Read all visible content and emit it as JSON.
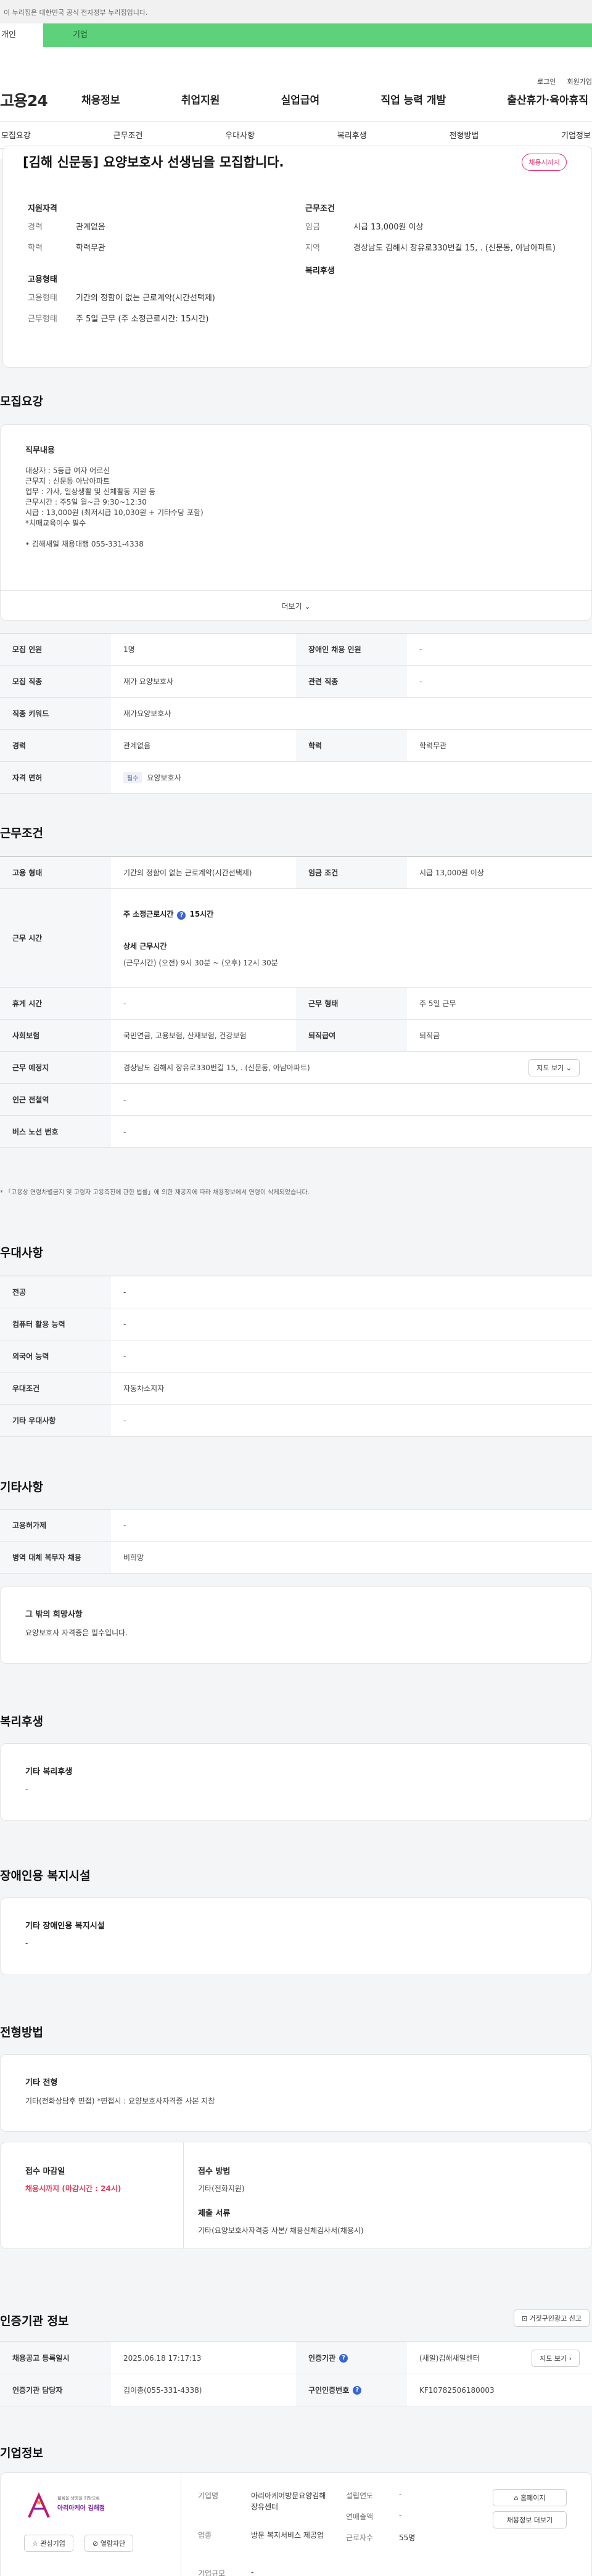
{
  "topbar": {
    "notice": "이 누리집은 대한민국 공식 전자정부 누리집입니다."
  },
  "tabs": {
    "person": "개인",
    "enterprise": "기업"
  },
  "header": {
    "login": "로그인",
    "signup": "회원가입",
    "logo": "고용24",
    "gnb": [
      "채용정보",
      "취업지원",
      "실업급여",
      "직업 능력 개발",
      "출산휴가·육아휴직"
    ],
    "anchors": [
      "모집요강",
      "근무조건",
      "우대사항",
      "복리후생",
      "전형방법",
      "기업정보"
    ]
  },
  "summary": {
    "title": "[김해 신문동] 요양보호사 선생님을 모집합니다.",
    "badge": "채용시까지",
    "qual_heading": "지원자격",
    "career_k": "경력",
    "career_v": "관계없음",
    "edu_k": "학력",
    "edu_v": "학력무관",
    "emp_heading": "고용형태",
    "emptype_k": "고용형태",
    "emptype_v": "기간의 정함이 없는 근로계약(시간선택제)",
    "worktype_k": "근무형태",
    "worktype_v": "주 5일 근무 (주 소정근로시간: 15시간)",
    "cond_heading": "근무조건",
    "wage_k": "임금",
    "wage_v": "시급 13,000원 이상",
    "region_k": "지역",
    "region_v": "경상남도 김해시 장유로330번길 15, . (신문동, 아남아파트)",
    "welfare_heading": "복리후생"
  },
  "recruit": {
    "heading": "모집요강",
    "duty_heading": "직무내용",
    "duty_lines": [
      "대상자 : 5등급 여자 어르신",
      "근무지 : 신문동 아남아파트",
      "업무 : 가사, 일상생활 및 신체활동 지원 등",
      "근무시간 : 주5일 월~금 9:30~12:30",
      "시급 : 13,000원 (최저시급 10,030원 + 기타수당 포함)",
      "*치매교육이수 필수",
      "",
      "• 김해새일 채용대행 055-331-4338"
    ],
    "more": "더보기",
    "rows": [
      {
        "k": "모집 인원",
        "v": "1명",
        "k2": "장애인 채용 인원",
        "v2": "-"
      },
      {
        "k": "모집 직종",
        "v": "재가 요양보호사",
        "k2": "관련 직종",
        "v2": "-"
      },
      {
        "k": "직종 키워드",
        "v": "재가요양보호사"
      },
      {
        "k": "경력",
        "v": "관계없음",
        "k2": "학력",
        "v2": "학력무관"
      },
      {
        "k": "자격 면허",
        "v": "요양보호사",
        "tag": "필수"
      }
    ]
  },
  "conditions": {
    "heading": "근무조건",
    "emptype_k": "고용 형태",
    "emptype_v": "기간의 정함이 없는 근로계약(시간선택제)",
    "wage_k": "임금 조건",
    "wage_v": "시급 13,000원 이상",
    "hours_k": "근무 시간",
    "weekly_label": "주 소정근로시간",
    "weekly_v": "15시간",
    "detail_label": "상세 근무시간",
    "detail_v": "(근무시간) (오전) 9시 30분 ~ (오후) 12시 30분",
    "rest_k": "휴게 시간",
    "rest_v": "-",
    "worktype_k": "근무 형태",
    "worktype_v": "주 5일 근무",
    "insurance_k": "사회보험",
    "insurance_v": "국민연금, 고용보험, 산재보험, 건강보험",
    "severance_k": "퇴직급여",
    "severance_v": "퇴직금",
    "place_k": "근무 예정지",
    "place_v": "경상남도 김해시 장유로330번길 15, . (신문동, 아남아파트)",
    "map_btn": "지도 보기",
    "subway_k": "인근 전철역",
    "subway_v": "-",
    "bus_k": "버스 노선 번호",
    "bus_v": "-",
    "note": "* 「고용상 연령차별금지 및 고령자 고용촉진에 관한 법률」에 의한 재공지에 따라 채용정보에서 연령이 삭제되었습니다."
  },
  "preference": {
    "heading": "우대사항",
    "rows": [
      {
        "k": "전공",
        "v": "-"
      },
      {
        "k": "컴퓨터 활용 능력",
        "v": "-"
      },
      {
        "k": "외국어 능력",
        "v": "-"
      },
      {
        "k": "우대조건",
        "v": "자동차소지자"
      },
      {
        "k": "기타 우대사항",
        "v": "-"
      }
    ]
  },
  "etc": {
    "heading": "기타사항",
    "rows": [
      {
        "k": "고용허가제",
        "v": "-"
      },
      {
        "k": "병역 대체 복무자 채용",
        "v": "비희망"
      }
    ],
    "other_heading": "그 밖의 희망사항",
    "other_text": "요양보호사 자격증은 필수입니다."
  },
  "welfare": {
    "heading": "복리후생",
    "sub": "기타 복리후생",
    "value": "-"
  },
  "disabled": {
    "heading": "장애인용 복지시설",
    "sub": "기타 장애인용 복지시설",
    "value": "-"
  },
  "selection": {
    "heading": "전형방법",
    "sub": "기타 전형",
    "text": "기타(전화상담후 면접) *면접시 : 요양보호사자격증 사본 지참",
    "deadline_h": "접수 마감일",
    "deadline_v": "채용시까지 (마감시간 : 24시)",
    "method_h": "접수 방법",
    "method_v": "기타(전화지원)",
    "docs_h": "제출 서류",
    "docs_v": "기타(요양보호사자격증 사본/ 채용신체검사서(채용시)"
  },
  "cert": {
    "heading": "인증기관 정보",
    "report_btn": "거짓구인광고 신고",
    "rows": [
      {
        "k": "채용공고 등록일시",
        "v": "2025.06.18 17:17:13",
        "k2": "인증기관",
        "v2": "(새일)김해새일센터",
        "btn": "지도 보기"
      },
      {
        "k": "인증기관 담당자",
        "v": "김이총(055-331-4338)",
        "k2": "구인인증번호",
        "v2": "KF10782506180003"
      }
    ]
  },
  "company": {
    "heading": "기업정보",
    "logo_sub": "젊음을 생명을 희망으로",
    "logo_main": "아리아케어 김해점",
    "fav_btn": "관심기업",
    "block_btn": "열람차단",
    "name_k": "기업명",
    "name_v": "아리아케어방문요양김해장유센터",
    "biz_k": "업종",
    "biz_v": "방문 복지서비스 제공업",
    "size_k": "기업규모",
    "size_v": "-",
    "year_k": "설립연도",
    "year_v": "-",
    "sales_k": "연매출액",
    "sales_v": "-",
    "staff_k": "근로자수",
    "staff_v": "55명",
    "home_btn": "홈페이지",
    "jobs_btn": "채용정보 더보기"
  }
}
